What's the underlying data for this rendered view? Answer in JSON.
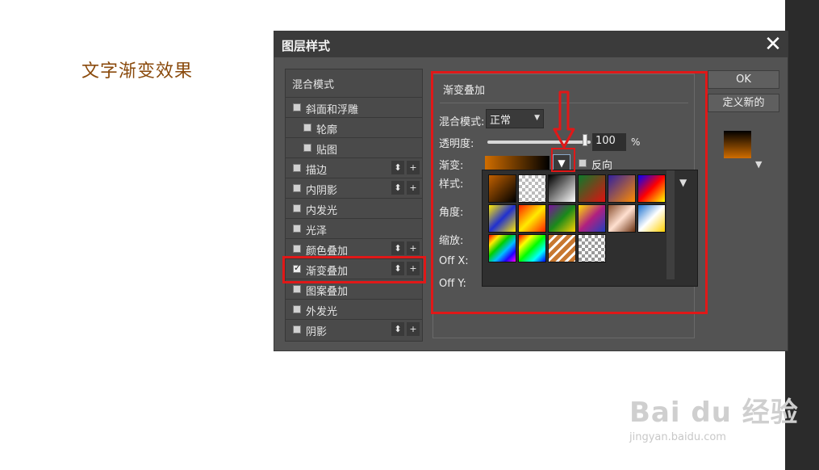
{
  "page": {
    "heading": "文字渐变效果"
  },
  "dialog": {
    "title": "图层样式",
    "close_glyph": "✕",
    "style_list": {
      "header": "混合模式",
      "items": [
        {
          "label": "斜面和浮雕",
          "checked": false,
          "buttons": false
        },
        {
          "label": "轮廓",
          "checked": false,
          "buttons": false
        },
        {
          "label": "贴图",
          "checked": false,
          "buttons": false
        },
        {
          "label": "描边",
          "checked": false,
          "buttons": true
        },
        {
          "label": "内阴影",
          "checked": false,
          "buttons": true
        },
        {
          "label": "内发光",
          "checked": false,
          "buttons": false
        },
        {
          "label": "光泽",
          "checked": false,
          "buttons": false
        },
        {
          "label": "颜色叠加",
          "checked": false,
          "buttons": true
        },
        {
          "label": "渐变叠加",
          "checked": true,
          "buttons": true
        },
        {
          "label": "图案叠加",
          "checked": false,
          "buttons": false
        },
        {
          "label": "外发光",
          "checked": false,
          "buttons": false
        },
        {
          "label": "阴影",
          "checked": false,
          "buttons": true
        }
      ],
      "move_glyph": "⬍",
      "add_glyph": "+"
    },
    "panel": {
      "title": "渐变叠加",
      "blend_mode_label": "混合模式:",
      "blend_mode_value": "正常",
      "opacity_label": "透明度:",
      "opacity_value": "100",
      "opacity_unit": "%",
      "opacity_fraction": 1.0,
      "gradient_label": "渐变:",
      "reverse_label": "反向",
      "style_label": "样式:",
      "angle_label": "角度:",
      "scale_label": "缩放:",
      "offx_label": "Off X:",
      "offy_label": "Off Y:",
      "dropdown_glyph": "▼"
    },
    "buttons": {
      "ok": "OK",
      "new": "定义新的"
    },
    "preview_arrow": "▼"
  },
  "gradient_presets": [
    "linear-gradient(135deg,#c06000,#000)",
    "repeating-conic-gradient(#bbb 0 25%,#fff 0 50%) 0 0/8px 8px",
    "linear-gradient(135deg,#000,#fff)",
    "linear-gradient(135deg,#0a7a2a,#e01010)",
    "linear-gradient(135deg,#3020a0,#ff8c00)",
    "linear-gradient(135deg,#0000ff,#ff0000,#ffff00)",
    "linear-gradient(135deg,#ffea00,#2030d0,#ffea00)",
    "linear-gradient(135deg,#ff2000,#ffea00,#ff2000)",
    "linear-gradient(135deg,#7a0fa0,#1a8a1a,#ffd000)",
    "linear-gradient(135deg,#ffe000,#b02080,#2040c0)",
    "linear-gradient(135deg,#8a5030,#ffe0d0,#6a3010)",
    "linear-gradient(135deg,#1a70d0,#ffffff,#ffd000)",
    "linear-gradient(135deg,#ff0000,#ffea00,#00d000,#00c0ff,#2000ff,#ff00ff)",
    "linear-gradient(135deg,#ff0000,#ffff00,#00ff00,#00ffff,#0000ff)",
    "repeating-linear-gradient(135deg,#c87830 0 5px,#fff 5px 8px)",
    "repeating-conic-gradient(#999 0 25%,#fff 0 50%) 0 0/8px 8px"
  ],
  "watermark": {
    "logo": "Bai du 经验",
    "url": "jingyan.baidu.com"
  }
}
